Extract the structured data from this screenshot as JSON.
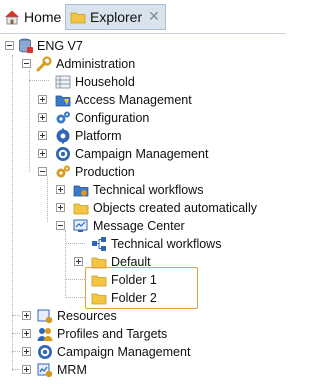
{
  "tabs": [
    {
      "label": "Home"
    },
    {
      "label": "Explorer",
      "close": "✕"
    }
  ],
  "tree": {
    "root": "ENG V7",
    "administration": "Administration",
    "household": "Household",
    "access_management": "Access Management",
    "configuration": "Configuration",
    "platform": "Platform",
    "campaign_management_admin": "Campaign Management",
    "production": "Production",
    "technical_workflows": "Technical workflows",
    "objects_created": "Objects created automatically",
    "message_center": "Message Center",
    "mc_technical_workflows": "Technical workflows",
    "default": "Default",
    "folder1": "Folder 1",
    "folder2": "Folder 2",
    "resources": "Resources",
    "profiles_targets": "Profiles and Targets",
    "campaign_management": "Campaign Management",
    "mrm": "MRM"
  },
  "colors": {
    "highlight": "#e0a23c",
    "folder": "#f4c542",
    "active_tab": "#d9e3ee"
  }
}
